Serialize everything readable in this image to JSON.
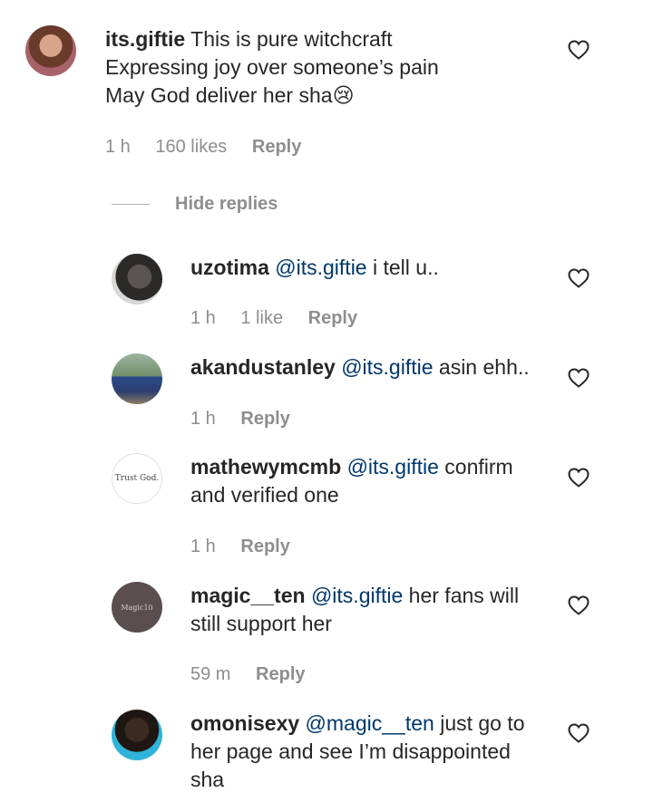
{
  "comments": [
    {
      "username": "its.giftie",
      "text": "This is pure witchcraft\nExpressing joy over someone’s pain\nMay God deliver her sha",
      "emoji": "😢",
      "time": "1 h",
      "likes": "160 likes",
      "reply": "Reply"
    },
    {
      "username": "uzotima",
      "mention": "@its.giftie",
      "text": "i tell u..",
      "time": "1 h",
      "likes": "1 like",
      "reply": "Reply"
    },
    {
      "username": "akandustanley",
      "mention": "@its.giftie",
      "text": "asin ehh..",
      "time": "1 h",
      "reply": "Reply"
    },
    {
      "username": "mathewymcmb",
      "mention": "@its.giftie",
      "text": "confirm and verified one",
      "time": "1 h",
      "reply": "Reply",
      "avatar_text": "Trust God."
    },
    {
      "username": "magic__ten",
      "mention": "@its.giftie",
      "text": "her fans will still support her",
      "time": "59 m",
      "reply": "Reply",
      "avatar_text": "Magic10"
    },
    {
      "username": "omonisexy",
      "mention": "@magic__ten",
      "text": "just go to her page and see I’m disappointed sha"
    }
  ],
  "hide_replies": "Hide replies",
  "colors": {
    "mention": "#00376b",
    "meta": "#8e8e8e",
    "text": "#262626"
  },
  "icons": [
    "heart-icon",
    "avatar"
  ]
}
